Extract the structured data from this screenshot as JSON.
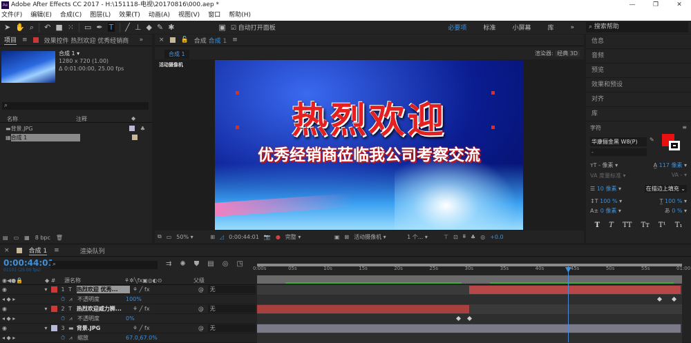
{
  "app": {
    "title": "Adobe After Effects CC 2017 - H:\\151118-电视\\20170816\\000.aep *",
    "logo": "Ae",
    "win_buttons": [
      "—",
      "❐",
      "✕"
    ]
  },
  "menu": [
    "文件(F)",
    "编辑(E)",
    "合成(C)",
    "图层(L)",
    "效果(T)",
    "动画(A)",
    "视图(V)",
    "窗口",
    "帮助(H)"
  ],
  "toolbar": {
    "auto_open_panel": "自动打开面板",
    "workspaces": [
      "必要项",
      "标准",
      "小屏幕",
      "库"
    ],
    "active_workspace": "必要项",
    "more": "»",
    "search_placeholder": "搜索帮助"
  },
  "project": {
    "tab": "项目",
    "effects_tab": "效果控件 热烈欢迎 优秀经销商",
    "more": "»",
    "comp_name": "合成 1 ▾",
    "resolution": "1280 x 720 (1.00)",
    "duration": "Δ 0:01:00:00, 25.00 fps",
    "col_name": "名称",
    "col_comment": "注释",
    "items": [
      {
        "name": "背景.JPG",
        "color": "#b8b8d8"
      },
      {
        "name": "合成 1",
        "color": "#c8b89a"
      }
    ],
    "bpc": "8 bpc"
  },
  "comp": {
    "tab_prefix": "合成",
    "tab_name": "合成 1",
    "breadcrumb": "合成 1",
    "renderer_label": "渲染器:",
    "renderer": "经典 3D",
    "camera_label": "活动摄像机",
    "preview_title": "热烈欢迎",
    "preview_subtitle": "优秀经销商莅临我公司考察交流",
    "bottom": {
      "zoom": "50%",
      "timecode": "0:00:44:01",
      "quality": "完整",
      "view": "活动摄像机",
      "views": "1 个...",
      "exposure": "+0.0"
    }
  },
  "right_panel": {
    "items": [
      "信息",
      "音频",
      "预览",
      "效果和预设",
      "对齐",
      "库"
    ],
    "character": {
      "title": "字符",
      "font": "华康俪金黑 W8(P)",
      "style": "-",
      "fill_color": "#e81010",
      "size": "- 像素",
      "leading": "117 像素",
      "kerning": "度量标准",
      "tracking": "-",
      "stroke_width": "10 像素",
      "stroke_mode": "在描边上填充",
      "vscale": "100 %",
      "hscale": "100 %",
      "baseline": "0 像素",
      "tsume": "0 %",
      "styles": [
        "T",
        "T",
        "TT",
        "Tт",
        "T¹",
        "T₁"
      ]
    }
  },
  "timeline": {
    "tab": "合成 1",
    "render_queue": "渲染队列",
    "timecode": "0:00:44:01",
    "frame_info": "01101 (25.00 fps)",
    "col_source": "源名称",
    "col_parent": "父级",
    "ruler": [
      "0:00s",
      "05s",
      "10s",
      "15s",
      "20s",
      "25s",
      "30s",
      "35s",
      "40s",
      "45s",
      "50s",
      "55s",
      "01:00"
    ],
    "duration_s": 60,
    "current_s": 44.04,
    "work_area": [
      [
        4,
        29
      ],
      [
        33,
        59
      ]
    ],
    "layers": [
      {
        "num": "1",
        "type": "T",
        "name": "热烈欢迎 优秀...",
        "color": "#d03838",
        "parent": "无",
        "prop": "不透明度",
        "prop_value": "100%",
        "in_s": 30,
        "out_s": 60,
        "bar_color": "#b84848",
        "keys": [
          57,
          59
        ]
      },
      {
        "num": "2",
        "type": "T",
        "name": "热烈欢迎威力狮...",
        "color": "#d03838",
        "parent": "无",
        "prop": "不透明度",
        "prop_value": "0%",
        "in_s": 0,
        "out_s": 30,
        "bar_color": "#a84040",
        "keys": [
          28.5,
          30
        ]
      },
      {
        "num": "3",
        "type": "img",
        "name": "背景.JPG",
        "color": "#b8b8d8",
        "parent": "无",
        "prop": "缩放",
        "prop_value": "67.0,67.0%",
        "in_s": 0,
        "out_s": 60,
        "bar_color": "#7a7a88",
        "keys": []
      }
    ]
  }
}
